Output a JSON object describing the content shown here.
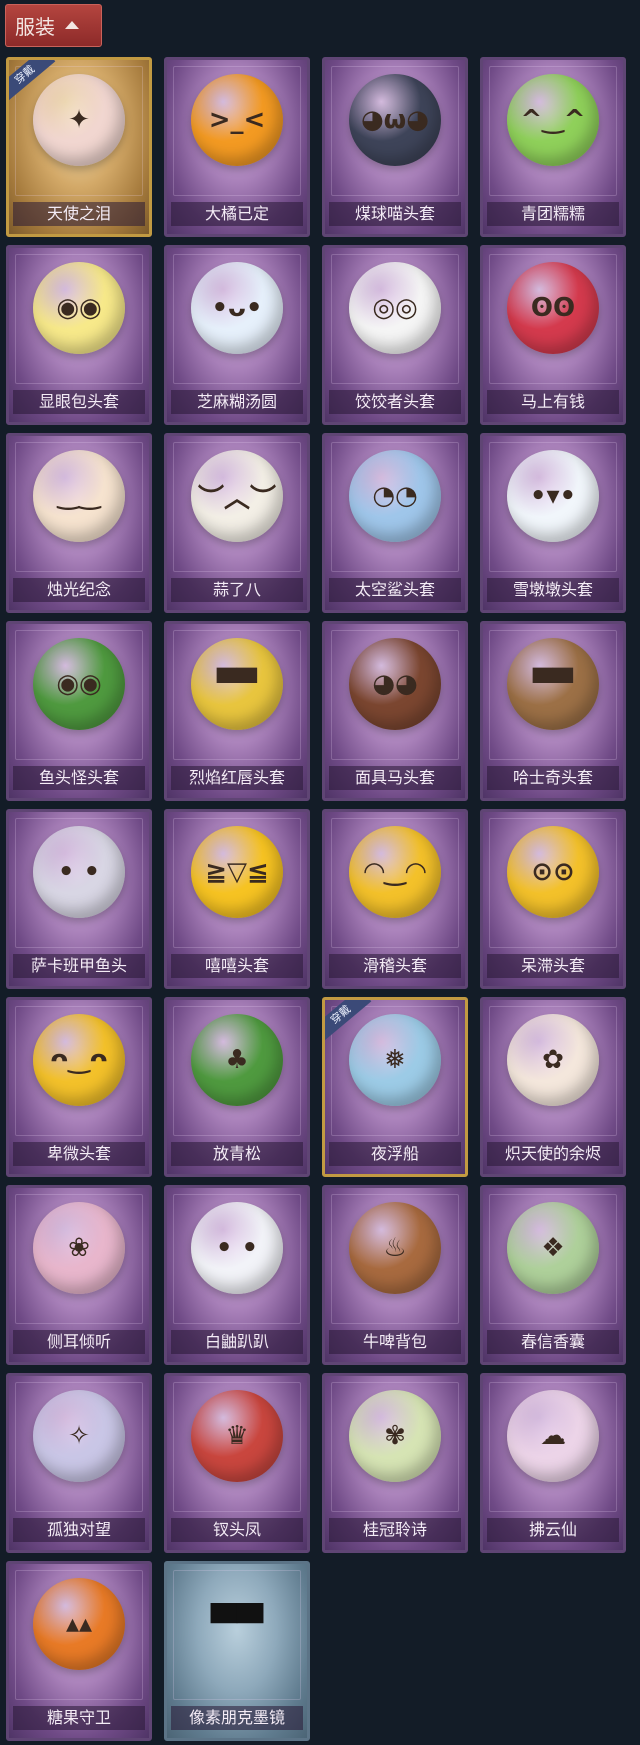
{
  "header": {
    "label": "服装"
  },
  "tag_label": "穿戴",
  "items": [
    {
      "name": "天使之泪",
      "icon": "angel-halo-icon",
      "color": "#f1d6d0",
      "glyph": "✦",
      "equipped": true,
      "style": "gold"
    },
    {
      "name": "大橘已定",
      "icon": "orange-head-icon",
      "color": "#f39a22",
      "glyph": ">_<"
    },
    {
      "name": "煤球喵头套",
      "icon": "cat-head-icon",
      "color": "#3e4459",
      "glyph": "◕ω◕"
    },
    {
      "name": "青团糯糯",
      "icon": "green-bun-icon",
      "color": "#8fd05a",
      "glyph": "^‿^"
    },
    {
      "name": "显眼包头套",
      "icon": "lightbulb-head-icon",
      "color": "#f7e98a",
      "glyph": "◉◉"
    },
    {
      "name": "芝麻糊汤圆",
      "icon": "rice-ball-icon",
      "color": "#e6f0fb",
      "glyph": "•ᴗ•"
    },
    {
      "name": "饺饺者头套",
      "icon": "dumpling-head-icon",
      "color": "#f5f5f5",
      "glyph": "◎◎"
    },
    {
      "name": "马上有钱",
      "icon": "horse-head-icon",
      "color": "#d43a4d",
      "glyph": "ʘʘ"
    },
    {
      "name": "烛光纪念",
      "icon": "candle-icon",
      "color": "#f6e3cf",
      "glyph": "‿‿"
    },
    {
      "name": "蒜了八",
      "icon": "garlic-icon",
      "color": "#f3efe6",
      "glyph": "︶︿︶"
    },
    {
      "name": "太空鲨头套",
      "icon": "shark-head-icon",
      "color": "#9fc6ea",
      "glyph": "◔◔"
    },
    {
      "name": "雪墩墩头套",
      "icon": "snowman-head-icon",
      "color": "#f1f6fb",
      "glyph": "•▾•"
    },
    {
      "name": "鱼头怪头套",
      "icon": "fish-head-icon",
      "color": "#4f9a3f",
      "glyph": "◉◉"
    },
    {
      "name": "烈焰红唇头套",
      "icon": "pikachu-head-icon",
      "color": "#e8c53e",
      "glyph": "▀▀"
    },
    {
      "name": "面具马头套",
      "icon": "horse-mask-icon",
      "color": "#7b4630",
      "glyph": "◕◕"
    },
    {
      "name": "哈士奇头套",
      "icon": "husky-head-icon",
      "color": "#9c7046",
      "glyph": "▀▀"
    },
    {
      "name": "萨卡班甲鱼头",
      "icon": "fish-plush-icon",
      "color": "#d8d6e4",
      "glyph": "• •"
    },
    {
      "name": "嘻嘻头套",
      "icon": "grin-emoji-icon",
      "color": "#f6c322",
      "glyph": "≧▽≦"
    },
    {
      "name": "滑稽头套",
      "icon": "smirk-emoji-icon",
      "color": "#f3c12a",
      "glyph": "◠‿◠"
    },
    {
      "name": "呆滞头套",
      "icon": "blank-emoji-icon",
      "color": "#f3c12a",
      "glyph": "⊙⊙"
    },
    {
      "name": "卑微头套",
      "icon": "shy-emoji-icon",
      "color": "#f3c12a",
      "glyph": "ᴖ‿ᴖ"
    },
    {
      "name": "放青松",
      "icon": "pine-tree-icon",
      "color": "#4f9a3f",
      "glyph": "♣"
    },
    {
      "name": "夜浮船",
      "icon": "jellyfish-icon",
      "color": "#9ccbe6",
      "glyph": "❅",
      "equipped": true,
      "style": "purple"
    },
    {
      "name": "炽天使的余烬",
      "icon": "angel-doll-icon",
      "color": "#f4e7dc",
      "glyph": "✿"
    },
    {
      "name": "侧耳倾听",
      "icon": "flower-wreath-icon",
      "color": "#e8b6cc",
      "glyph": "❀"
    },
    {
      "name": "白鼬趴趴",
      "icon": "weasel-plush-icon",
      "color": "#f2f3f8",
      "glyph": "• •"
    },
    {
      "name": "牛啤背包",
      "icon": "beer-barrel-icon",
      "color": "#a86a3f",
      "glyph": "♨"
    },
    {
      "name": "春信香囊",
      "icon": "sachet-icon",
      "color": "#aed09a",
      "glyph": "❖"
    },
    {
      "name": "孤独对望",
      "icon": "doll-charm-icon",
      "color": "#c9c6e6",
      "glyph": "✧"
    },
    {
      "name": "钗头凤",
      "icon": "phoenix-crown-icon",
      "color": "#c9463e",
      "glyph": "♛"
    },
    {
      "name": "桂冠聆诗",
      "icon": "laurel-charm-icon",
      "color": "#d6e4b4",
      "glyph": "✾"
    },
    {
      "name": "拂云仙",
      "icon": "cloud-fairy-icon",
      "color": "#ecd4e8",
      "glyph": "☁"
    },
    {
      "name": "糖果守卫",
      "icon": "pumpkin-charm-icon",
      "color": "#e87a26",
      "glyph": "▴▴"
    },
    {
      "name": "像素朋克墨镜",
      "icon": "pixel-sunglasses-icon",
      "color": "#1a1a1a",
      "glyph": "▀▀",
      "style": "blue"
    }
  ]
}
